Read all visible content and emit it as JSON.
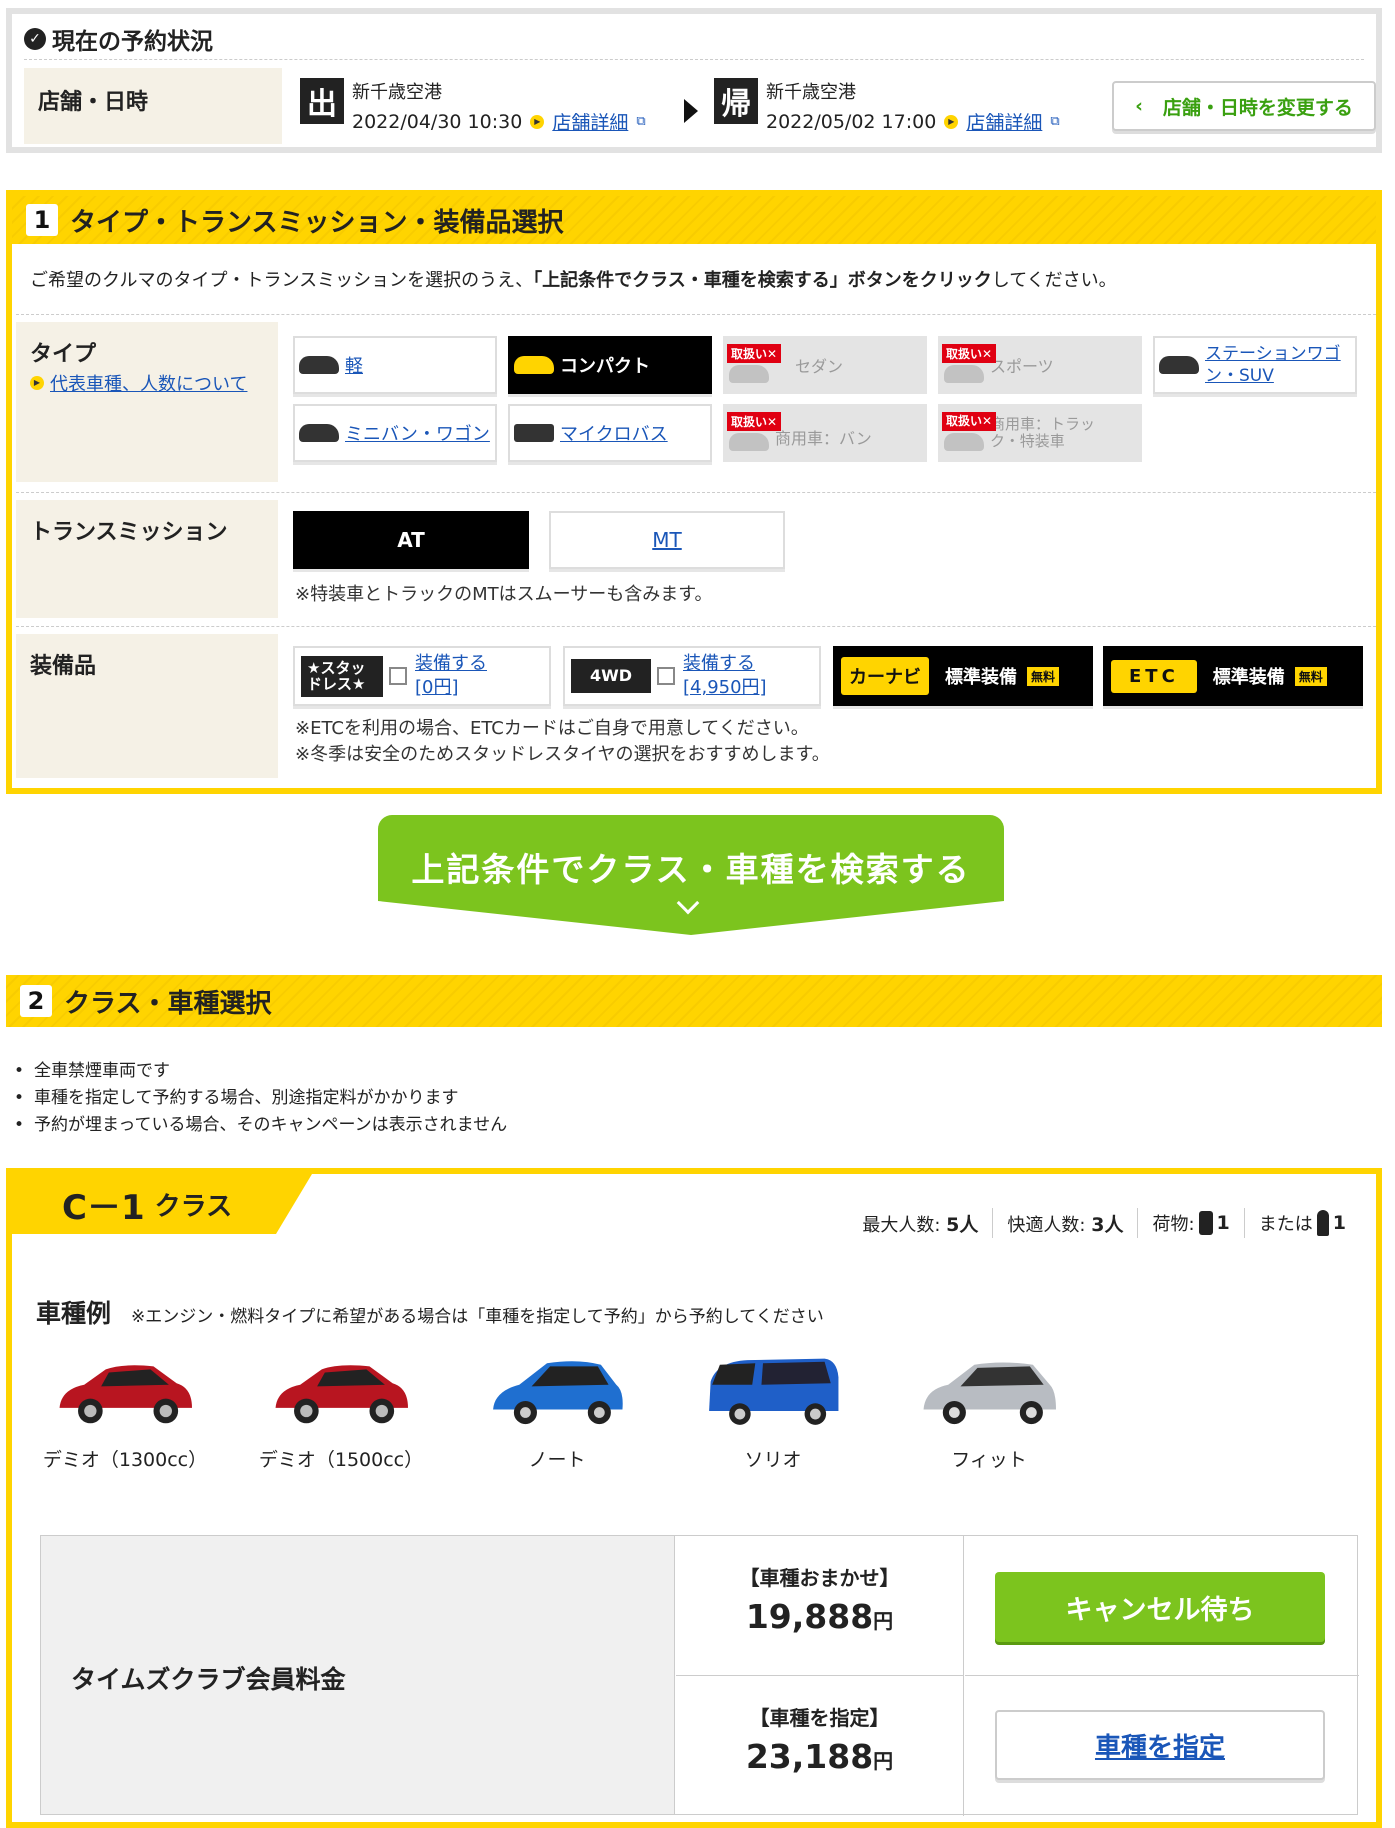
{
  "status": {
    "title": "現在の予約状況",
    "label": "店舗・日時",
    "out": {
      "badge": "出",
      "store": "新千歳空港",
      "datetime": "2022/04/30 10:30",
      "detail": "店舗詳細"
    },
    "ret": {
      "badge": "帰",
      "store": "新千歳空港",
      "datetime": "2022/05/02 17:00",
      "detail": "店舗詳細"
    },
    "change": "店舗・日時を変更する"
  },
  "step1": {
    "num": "1",
    "title": "タイプ・トランスミッション・装備品選択",
    "note_pre": "ご希望のクルマのタイプ・トランスミッションを選択のうえ、",
    "note_bold": "「上記条件でクラス・車種を検索する」ボタンをクリック",
    "note_post": "してください。",
    "type_label": "タイプ",
    "type_link": "代表車種、人数について",
    "types": [
      "軽",
      "コンパクト",
      "セダン",
      "スポーツ",
      "ステーションワゴン・SUV",
      "ミニバン・ワゴン",
      "マイクロバス",
      "商用車：バン",
      "商用車：トラック・特装車"
    ],
    "unavailable": "取扱い✕",
    "tm_label": "トランスミッション",
    "tm": [
      "AT",
      "MT"
    ],
    "tm_note": "※特装車とトラックのMTはスムーサーも含みます。",
    "eq_label": "装備品",
    "studless": {
      "tag": "★スタッドレス★",
      "a": "装備する",
      "b": "[0円]"
    },
    "fourwd": {
      "tag": "4WD",
      "a": "装備する",
      "b": "[4,950円]"
    },
    "navi": {
      "tag": "カーナビ",
      "text": "標準装備",
      "free": "無料"
    },
    "etc": {
      "tag": "ETC",
      "text": "標準装備",
      "free": "無料"
    },
    "eq_note1": "※ETCを利用の場合、ETCカードはご自身で用意してください。",
    "eq_note2": "※冬季は安全のためスタッドレスタイヤの選択をおすすめします。"
  },
  "search_button": "上記条件でクラス・車種を検索する",
  "step2": {
    "num": "2",
    "title": "クラス・車種選択",
    "bullets": [
      "全車禁煙車両です",
      "車種を指定して予約する場合、別途指定料がかかります",
      "予約が埋まっている場合、そのキャンペーンは表示されません"
    ]
  },
  "class": {
    "name": "C－1",
    "suffix": "クラス",
    "max_label": "最大人数:",
    "max": "5人",
    "comfort_label": "快適人数:",
    "comfort": "3人",
    "luggage_label": "荷物:",
    "luggage": "1",
    "or_label": "または",
    "golf": "1",
    "examples_title": "車種例",
    "examples_note": "※エンジン・燃料タイプに希望がある場合は「車種を指定して予約」から予約してください",
    "cars": [
      "デミオ（1300cc）",
      "デミオ（1500cc）",
      "ノート",
      "ソリオ",
      "フィット"
    ],
    "colors": [
      "#b81520",
      "#b81520",
      "#1f6fd0",
      "#1f5fc8",
      "#b8bcc2"
    ],
    "price_label": "タイムズクラブ会員料金",
    "omakase_label": "【車種おまかせ】",
    "omakase_price": "19,888",
    "yen": "円",
    "shitei_label": "【車種を指定】",
    "shitei_price": "23,188",
    "cancel_wait": "キャンセル待ち",
    "select_car": "車種を指定"
  }
}
